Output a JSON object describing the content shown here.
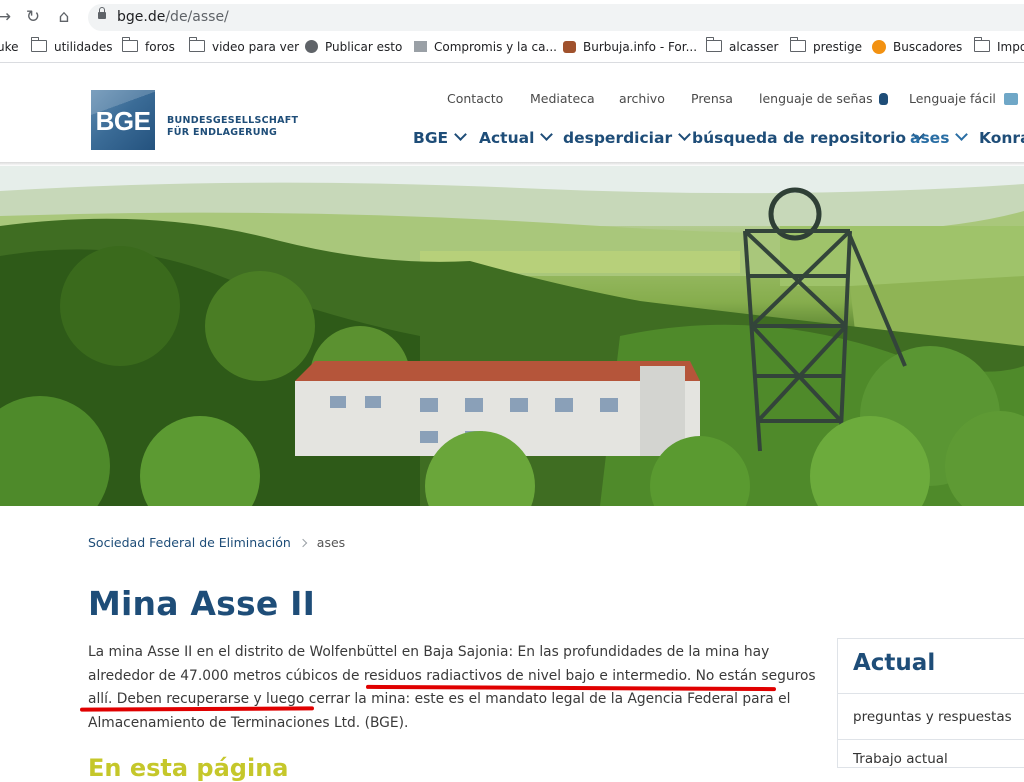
{
  "browser": {
    "url_host": "bge.de",
    "url_path": "/de/asse/",
    "bookmarks": [
      {
        "label": "uke",
        "icon": "folder-icon"
      },
      {
        "label": "utilidades",
        "icon": "folder-icon"
      },
      {
        "label": "foros",
        "icon": "folder-icon"
      },
      {
        "label": "video para ver",
        "icon": "folder-icon"
      },
      {
        "label": "Publicar esto",
        "icon": "globe-icon"
      },
      {
        "label": "Compromis y la ca...",
        "icon": "site-favicon"
      },
      {
        "label": "Burbuja.info - For...",
        "icon": "site-favicon"
      },
      {
        "label": "alcasser",
        "icon": "folder-icon"
      },
      {
        "label": "prestige",
        "icon": "folder-icon"
      },
      {
        "label": "Buscadores",
        "icon": "site-favicon"
      },
      {
        "label": "Impo",
        "icon": "folder-icon"
      }
    ]
  },
  "header": {
    "logo_text": "BGE",
    "logo_caption_1": "BUNDESGESELLSCHAFT",
    "logo_caption_2": "FÜR ENDLAGERUNG",
    "utility_nav": [
      "Contacto",
      "Mediateca",
      "archivo",
      "Prensa",
      "lenguaje de señas",
      "Lenguaje fácil"
    ],
    "main_nav": [
      "BGE",
      "Actual",
      "desperdiciar",
      "búsqueda de repositorio",
      "ases",
      "Konra"
    ],
    "active_nav": "ases"
  },
  "breadcrumb": {
    "home": "Sociedad Federal de Eliminación",
    "current": "ases"
  },
  "page": {
    "title": "Mina Asse II",
    "intro": "La mina Asse II en el distrito de Wolfenbüttel en Baja Sajonia: En las profundidades de la mina hay alrededor de 47.000 metros cúbicos de residuos radiactivos de nivel bajo e intermedio. No están seguros allí. Deben recuperarse y luego cerrar la mina: este es el mandato legal de la Agencia Federal para el Almacenamiento de Terminaciones Ltd. (BGE).",
    "section_peek": "En esta página"
  },
  "sidebar": {
    "title": "Actual",
    "items": [
      "preguntas y respuestas",
      "Trabajo actual"
    ]
  },
  "colors": {
    "brand_blue": "#1e4d78",
    "annotation_red": "#e00000",
    "section_yellow": "#c5c72a"
  }
}
